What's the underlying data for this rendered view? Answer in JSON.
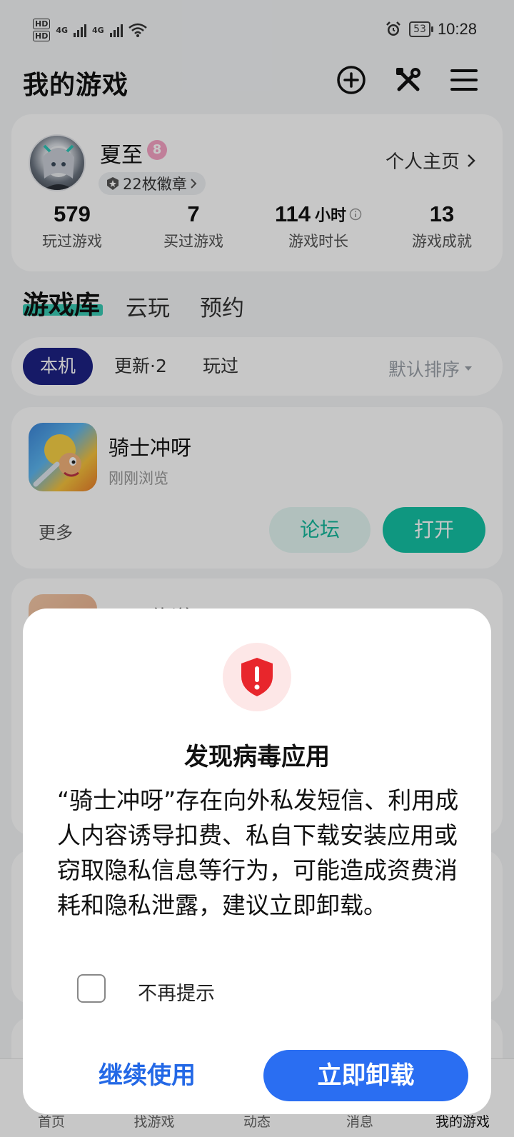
{
  "status_bar": {
    "hd1": "HD",
    "hd2": "HD",
    "net1": "4G",
    "net2": "4G",
    "battery": "53",
    "time": "10:28"
  },
  "header": {
    "title": "我的游戏",
    "icons": [
      "add-circle-icon",
      "tools-icon",
      "menu-icon"
    ]
  },
  "profile": {
    "name": "夏至",
    "level": "8",
    "badges": "22枚徽章",
    "home_link": "个人主页",
    "stats": [
      {
        "value": "579",
        "unit": "",
        "label": "玩过游戏"
      },
      {
        "value": "7",
        "unit": "",
        "label": "买过游戏"
      },
      {
        "value": "114",
        "unit": "小时",
        "label": "游戏时长"
      },
      {
        "value": "13",
        "unit": "",
        "label": "游戏成就"
      }
    ]
  },
  "tabs": [
    "游戏库",
    "云玩",
    "预约"
  ],
  "filters": {
    "chips": [
      "本机",
      "更新·2",
      "玩过"
    ],
    "sort": "默认排序"
  },
  "game": {
    "name": "骑士冲呀",
    "subtitle": "刚刚浏览",
    "more": "更多",
    "forum": "论坛",
    "open": "打开"
  },
  "game2": {
    "name": "三国传说"
  },
  "bottom_nav": [
    "首页",
    "找游戏",
    "动态",
    "消息",
    "我的游戏"
  ],
  "dialog": {
    "title": "发现病毒应用",
    "message": "“骑士冲呀”存在向外私发短信、利用成人内容诱导扣费、私自下载安装应用或窃取隐私信息等行为，可能造成资费消耗和隐私泄露，建议立即卸载。",
    "checkbox_label": "不再提示",
    "continue": "继续使用",
    "uninstall": "立即卸载"
  },
  "colors": {
    "accent_teal": "#14c2a4",
    "chip_active": "#1d2284",
    "primary_blue": "#2a6ef2",
    "warning_red": "#e8262c"
  }
}
